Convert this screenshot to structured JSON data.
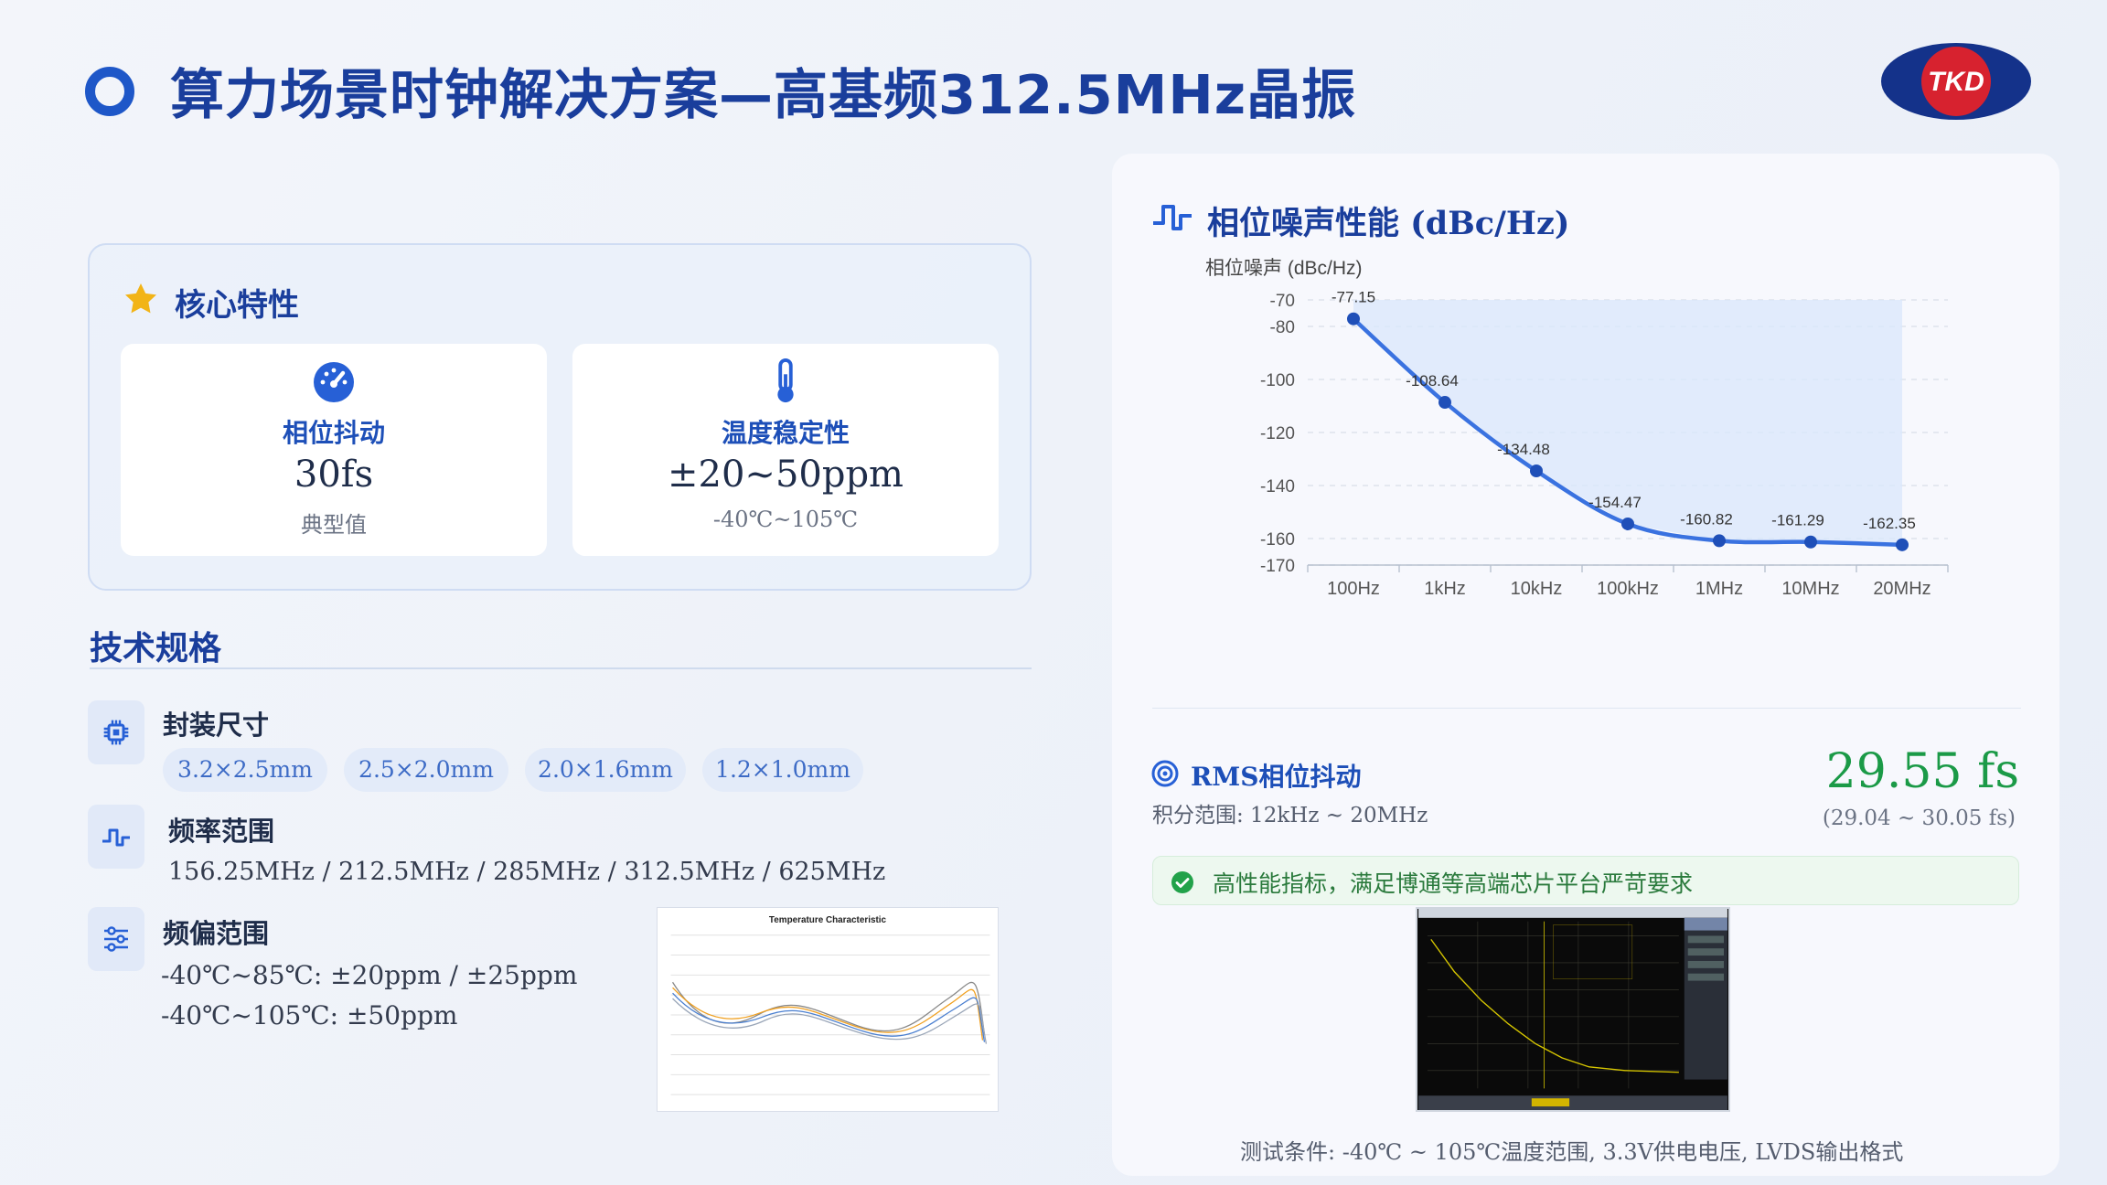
{
  "header": {
    "title": "算力场景时钟解决方案—高基频312.5MHz晶振",
    "logo_text": "TKD"
  },
  "core": {
    "title": "核心特性",
    "cards": [
      {
        "label": "相位抖动",
        "value": "30fs",
        "sub": "典型值",
        "icon": "speedometer-icon"
      },
      {
        "label": "温度稳定性",
        "value": "±20~50ppm",
        "sub": "-40℃~105℃",
        "icon": "thermometer-icon"
      }
    ]
  },
  "spec": {
    "title": "技术规格",
    "package": {
      "label": "封装尺寸",
      "sizes": [
        "3.2×2.5mm",
        "2.5×2.0mm",
        "2.0×1.6mm",
        "1.2×1.0mm"
      ],
      "icon": "chip-icon"
    },
    "frequency": {
      "label": "频率范围",
      "values": "156.25MHz / 212.5MHz / 285MHz / 312.5MHz / 625MHz",
      "icon": "waveform-icon"
    },
    "offset": {
      "label": "频偏范围",
      "lines": [
        "-40℃~85℃: ±20ppm / ±25ppm",
        "-40℃~105℃: ±50ppm"
      ],
      "icon": "sliders-icon"
    },
    "temp_image_title": "Temperature Characteristic"
  },
  "phase_noise": {
    "title": "相位噪声性能 (dBc/Hz)",
    "icon": "waveform-icon"
  },
  "chart_data": {
    "type": "area",
    "title": "",
    "ylabel": "相位噪声 (dBc/Hz)",
    "xlabel": "",
    "categories": [
      "100Hz",
      "1kHz",
      "10kHz",
      "100kHz",
      "1MHz",
      "10MHz",
      "20MHz"
    ],
    "values": [
      -77.15,
      -108.64,
      -134.48,
      -154.47,
      -160.82,
      -161.29,
      -162.35
    ],
    "data_labels": [
      "-77.15",
      "-108.64",
      "-134.48",
      "-154.47",
      "-160.82",
      "-161.29",
      "-162.35"
    ],
    "yticks": [
      -70,
      -80,
      -100,
      -120,
      -140,
      -160,
      -170
    ],
    "ylim": [
      -170,
      -70
    ],
    "grid": true,
    "color": "#3a72e0"
  },
  "rms": {
    "title": "RMS相位抖动",
    "range": "积分范围: 12kHz ~ 20MHz",
    "value": "29.55 fs",
    "tolerance": "(29.04 ~ 30.05 fs)",
    "value_color": "#1b9a47"
  },
  "status": {
    "text": "高性能指标，满足博通等高端芯片平台严苛要求",
    "color": "#2a7a3c"
  },
  "footer": {
    "test_note": "测试条件: -40℃ ~ 105℃温度范围, 3.3V供电电压, LVDS输出格式"
  }
}
